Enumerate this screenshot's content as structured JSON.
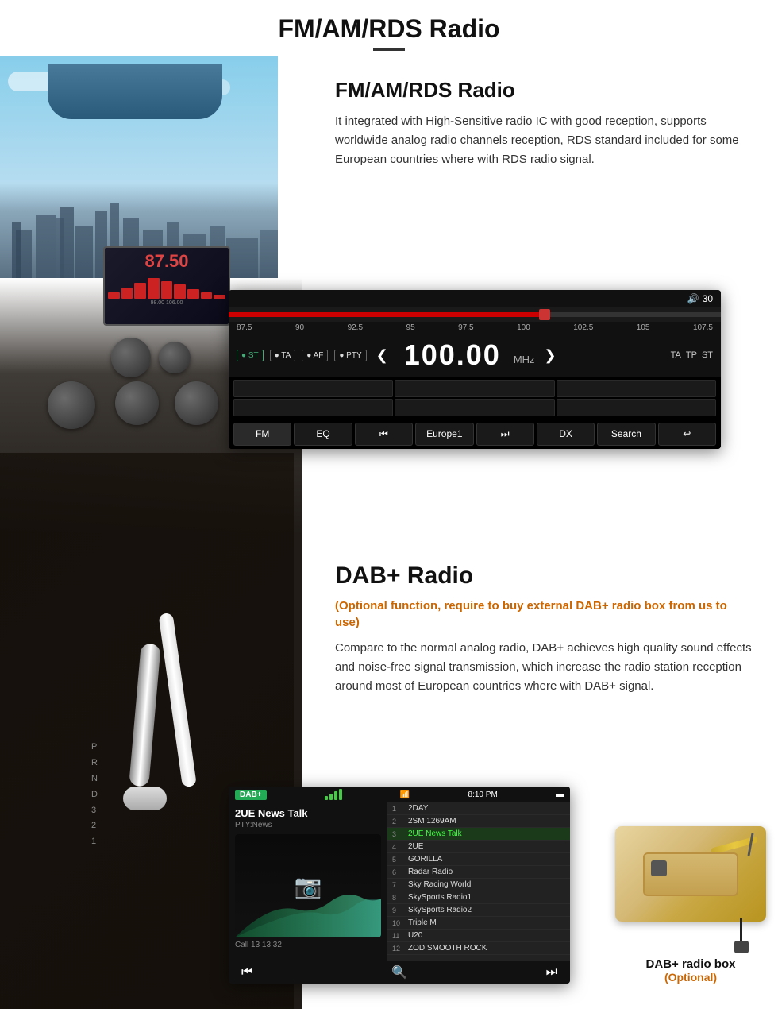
{
  "page": {
    "title": "FM/AM/RDS Radio"
  },
  "fm_section": {
    "title": "FM/AM/RDS Radio",
    "description": "It integrated with High-Sensitive radio IC with good reception, supports worldwide analog radio channels reception, RDS standard included for some European countries where with RDS radio signal."
  },
  "radio_ui": {
    "volume": "30",
    "frequency": "100.00",
    "unit": "MHz",
    "freq_scale": [
      "87.5",
      "90",
      "92.5",
      "95",
      "97.5",
      "100",
      "102.5",
      "105",
      "107.5"
    ],
    "badges": [
      "ST",
      "TA",
      "AF",
      "PTY"
    ],
    "extra": [
      "TA",
      "TP",
      "ST"
    ],
    "buttons": [
      "FM",
      "EQ",
      "⏮",
      "Europe1",
      "⏭",
      "DX",
      "Search",
      "↩"
    ]
  },
  "dab_section": {
    "title": "DAB+ Radio",
    "optional_text": "(Optional function, require to buy external DAB+ radio box from us to use)",
    "description": "Compare to the normal analog radio, DAB+ achieves high quality sound effects and noise-free signal transmission, which increase the radio station reception around most of European countries where with DAB+ signal."
  },
  "dab_ui": {
    "badge": "DAB+",
    "time": "8:10 PM",
    "station_name": "2UE News Talk",
    "pty": "PTY:News",
    "call": "Call 13 13 32",
    "stations": [
      {
        "num": "1",
        "name": "2DAY"
      },
      {
        "num": "2",
        "name": "2SM 1269AM"
      },
      {
        "num": "3",
        "name": "2UE News Talk",
        "active": true
      },
      {
        "num": "4",
        "name": "2UE"
      },
      {
        "num": "5",
        "name": "GORILLA"
      },
      {
        "num": "6",
        "name": "Radar Radio"
      },
      {
        "num": "7",
        "name": "Sky Racing World"
      },
      {
        "num": "8",
        "name": "SkySports Radio1"
      },
      {
        "num": "9",
        "name": "SkySports Radio2"
      },
      {
        "num": "10",
        "name": "Triple M"
      },
      {
        "num": "11",
        "name": "U20"
      },
      {
        "num": "12",
        "name": "ZOD SMOOTH ROCK"
      }
    ]
  },
  "dab_box": {
    "label": "DAB+ radio box",
    "optional": "(Optional)"
  },
  "head_unit": {
    "frequency": "87.50",
    "range": "98.00   106.00"
  }
}
